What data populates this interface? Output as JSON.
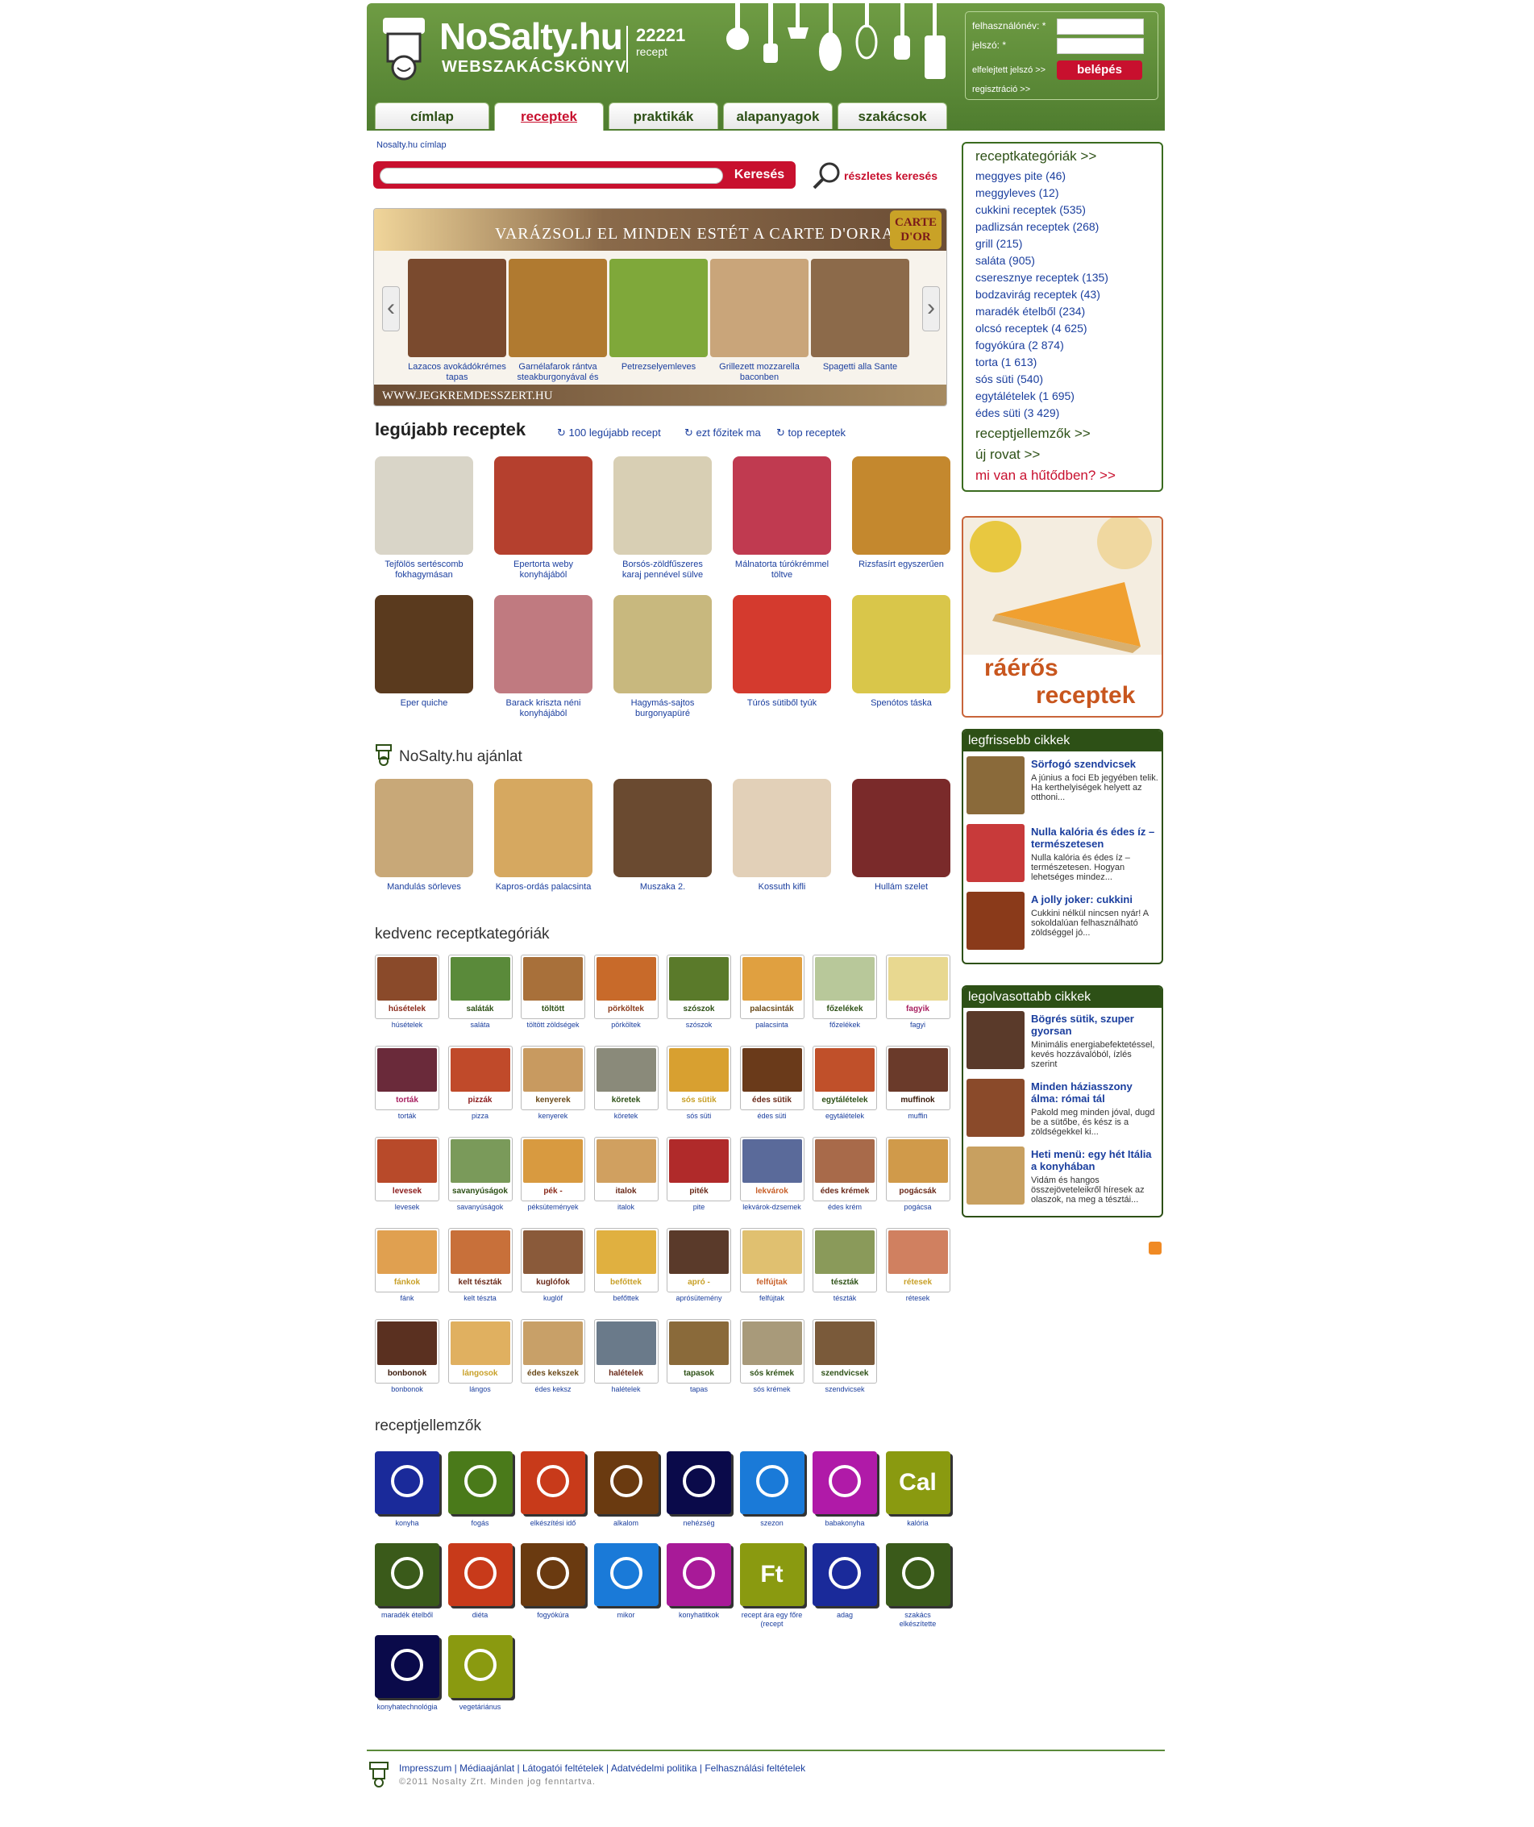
{
  "header": {
    "site_name": "NoSalty.hu",
    "tagline": "WEBSZAKÁCSKÖNYV",
    "recipe_count": "22221",
    "recipe_label": "recept"
  },
  "login": {
    "username_label": "felhasználónév: *",
    "password_label": "jelszó: *",
    "forgot_link": "elfelejtett jelszó >>",
    "register_link": "regisztráció >>",
    "submit": "belépés"
  },
  "tabs": [
    "címlap",
    "receptek",
    "praktikák",
    "alapanyagok",
    "szakácsok"
  ],
  "active_tab": "receptek",
  "breadcrumb": "Nosalty.hu címlap",
  "search": {
    "button": "Keresés",
    "advanced": "részletes keresés"
  },
  "promo": {
    "headline": "VARÁZSOLJ EL MINDEN ESTÉT A CARTE D'ORRAL!",
    "brand": "CARTE D'OR",
    "footer": "WWW.JEGKREMDESSZERT.HU",
    "items": [
      {
        "title": "Lazacos avokádókrémes tapas",
        "color": "#7a4a2e"
      },
      {
        "title": "Garnélafarok rántva steakburgonyával és",
        "color": "#b07a30"
      },
      {
        "title": "Petrezselyemleves",
        "color": "#7fa83a"
      },
      {
        "title": "Grillezett mozzarella baconben",
        "color": "#c9a57a"
      },
      {
        "title": "Spagetti alla Sante",
        "color": "#8c6a4a"
      }
    ]
  },
  "newest": {
    "title": "legújabb receptek",
    "links": [
      "100 legújabb recept",
      "ezt főzitek ma",
      "top receptek"
    ],
    "items": [
      {
        "title": "Tejfölös sertéscomb fokhagymásan",
        "color": "#d9d5c8"
      },
      {
        "title": "Epertorta weby konyhájából",
        "color": "#b5402e"
      },
      {
        "title": "Borsós-zöldfűszeres karaj pennével sülve",
        "color": "#d8cfb4"
      },
      {
        "title": "Málnatorta túrókrémmel töltve",
        "color": "#c03a50"
      },
      {
        "title": "Rizsfasírt egyszerűen",
        "color": "#c4882e"
      },
      {
        "title": "Eper quiche",
        "color": "#5a3a1e"
      },
      {
        "title": "Barack kriszta néni konyhájából",
        "color": "#c07a80"
      },
      {
        "title": "Hagymás-sajtos burgonyapüré",
        "color": "#c8b87e"
      },
      {
        "title": "Túrós sütiből tyúk",
        "color": "#d43a2e"
      },
      {
        "title": "Spenótos táska",
        "color": "#d9c64a"
      }
    ]
  },
  "recommend": {
    "title": "NoSalty.hu ajánlat",
    "items": [
      {
        "title": "Mandulás sörleves",
        "color": "#c8a878"
      },
      {
        "title": "Kapros-ordás palacsinta",
        "color": "#d6a860"
      },
      {
        "title": "Muszaka 2.",
        "color": "#6a4a30"
      },
      {
        "title": "Kossuth kifli",
        "color": "#e2d0b8"
      },
      {
        "title": "Hullám szelet",
        "color": "#7a2a2a"
      }
    ]
  },
  "categories": {
    "title": "kedvenc receptkategóriák",
    "items": [
      {
        "label": "húsételek",
        "caption": "húsételek",
        "color": "#8a4a2a",
        "lc": "#8a2a1a"
      },
      {
        "label": "saláták",
        "caption": "saláta",
        "color": "#5a8a3a",
        "lc": "#2d5016"
      },
      {
        "label": "töltött zöldségek",
        "caption": "töltött zöldségek",
        "color": "#a8703a",
        "lc": "#2d5016"
      },
      {
        "label": "pörköltek",
        "caption": "pörköltek",
        "color": "#c86a2a",
        "lc": "#8a3a1a"
      },
      {
        "label": "szószok",
        "caption": "szószok",
        "color": "#5a7a2a",
        "lc": "#2d5016"
      },
      {
        "label": "palacsinták",
        "caption": "palacsinta",
        "color": "#e0a040",
        "lc": "#6a4a1a"
      },
      {
        "label": "főzelékek",
        "caption": "főzelékek",
        "color": "#b8c89a",
        "lc": "#2d5016"
      },
      {
        "label": "fagyik",
        "caption": "fagyi",
        "color": "#e8d890",
        "lc": "#a82060"
      },
      {
        "label": "torták",
        "caption": "torták",
        "color": "#6a2a3a",
        "lc": "#a82060"
      },
      {
        "label": "pizzák",
        "caption": "pizza",
        "color": "#c04a2a",
        "lc": "#8a1a1a"
      },
      {
        "label": "kenyerek",
        "caption": "kenyerek",
        "color": "#c89a60",
        "lc": "#6a4a1a"
      },
      {
        "label": "köretek",
        "caption": "köretek",
        "color": "#8a8a7a",
        "lc": "#2d5016"
      },
      {
        "label": "sós sütik",
        "caption": "sós süti",
        "color": "#d8a030",
        "lc": "#c8a028"
      },
      {
        "label": "édes sütik",
        "caption": "édes süti",
        "color": "#6a3a1a",
        "lc": "#6a2a1a"
      },
      {
        "label": "egytálételek",
        "caption": "egytálételek",
        "color": "#c0502a",
        "lc": "#2d5016"
      },
      {
        "label": "muffinok",
        "caption": "muffin",
        "color": "#6a3a2a",
        "lc": "#3a1a0a"
      },
      {
        "label": "levesek",
        "caption": "levesek",
        "color": "#b84a2a",
        "lc": "#8a1a1a"
      },
      {
        "label": "savanyúságok",
        "caption": "savanyúságok",
        "color": "#7a9a5a",
        "lc": "#2d5016"
      },
      {
        "label": "pék - sütemények",
        "caption": "péksütemények",
        "color": "#d89a40",
        "lc": "#8a2a1a"
      },
      {
        "label": "italok",
        "caption": "italok",
        "color": "#d0a060",
        "lc": "#6a2a1a"
      },
      {
        "label": "piték",
        "caption": "pite",
        "color": "#b02a2a",
        "lc": "#6a2a1a"
      },
      {
        "label": "lekvárok dzsemek",
        "caption": "lekvárok-dzsemek",
        "color": "#5a6a9a",
        "lc": "#c8602a"
      },
      {
        "label": "édes krémek",
        "caption": "édes krém",
        "color": "#a86a4a",
        "lc": "#6a2a1a"
      },
      {
        "label": "pogácsák",
        "caption": "pogácsa",
        "color": "#d09a4a",
        "lc": "#6a2a1a"
      },
      {
        "label": "fánkok",
        "caption": "fánk",
        "color": "#e0a050",
        "lc": "#c8a028"
      },
      {
        "label": "kelt tészták",
        "caption": "kelt tészta",
        "color": "#c8703a",
        "lc": "#6a2a1a"
      },
      {
        "label": "kuglófok",
        "caption": "kuglóf",
        "color": "#8a5a3a",
        "lc": "#6a2a1a"
      },
      {
        "label": "befőttek",
        "caption": "befőttek",
        "color": "#e0b040",
        "lc": "#c8a028"
      },
      {
        "label": "apró - sütemények",
        "caption": "aprósütemény",
        "color": "#5a3a2a",
        "lc": "#c8a028"
      },
      {
        "label": "felfújtak",
        "caption": "felfújtak",
        "color": "#e0c070",
        "lc": "#c8602a"
      },
      {
        "label": "tészták",
        "caption": "tészták",
        "color": "#8a9a5a",
        "lc": "#2d5016"
      },
      {
        "label": "rétesek",
        "caption": "rétesek",
        "color": "#d08060",
        "lc": "#c8a028"
      },
      {
        "label": "bonbonok",
        "caption": "bonbonok",
        "color": "#5a3020",
        "lc": "#3a1a0a"
      },
      {
        "label": "lángosok",
        "caption": "lángos",
        "color": "#e0b060",
        "lc": "#c8a028"
      },
      {
        "label": "édes kekszek",
        "caption": "édes keksz",
        "color": "#c8a068",
        "lc": "#6a4a1a"
      },
      {
        "label": "halételek",
        "caption": "halételek",
        "color": "#6a7a8a",
        "lc": "#6a2a1a"
      },
      {
        "label": "tapasok",
        "caption": "tapas",
        "color": "#8a6a3a",
        "lc": "#2d5016"
      },
      {
        "label": "sós krémek",
        "caption": "sós krémek",
        "color": "#a89a7a",
        "lc": "#2d5016"
      },
      {
        "label": "szendvicsek",
        "caption": "szendvicsek",
        "color": "#7a5a3a",
        "lc": "#2d5016"
      }
    ]
  },
  "features": {
    "title": "receptjellemzők",
    "items": [
      {
        "caption": "konyha",
        "color": "#1a2a9a",
        "icon": "globe-icon"
      },
      {
        "caption": "fogás",
        "color": "#4a7a1a",
        "icon": "fork-knife-icon"
      },
      {
        "caption": "elkészítési idő",
        "color": "#c83a1a",
        "icon": "clock-icon"
      },
      {
        "caption": "alkalom",
        "color": "#6a3a10",
        "icon": "cake-icon"
      },
      {
        "caption": "nehézség",
        "color": "#0a0a4a",
        "icon": "spoons-icon"
      },
      {
        "caption": "szezon",
        "color": "#1a7ad8",
        "icon": "sun-snow-icon"
      },
      {
        "caption": "babakonyha",
        "color": "#b01aa8",
        "icon": "baby-icon"
      },
      {
        "caption": "kalória",
        "color": "#8a9a10",
        "icon": "cal-icon",
        "text": "Cal"
      },
      {
        "caption": "maradék ételből",
        "color": "#3a5a1a",
        "icon": "recycle-icon"
      },
      {
        "caption": "diéta",
        "color": "#c83a1a",
        "icon": "no-entry-icon"
      },
      {
        "caption": "fogyókúra",
        "color": "#6a3a10",
        "icon": "scale-icon"
      },
      {
        "caption": "mikor",
        "color": "#1a7ad8",
        "icon": "day-night-icon"
      },
      {
        "caption": "konyhatitkok",
        "color": "#a81a98",
        "icon": "lock-icon"
      },
      {
        "caption": "recept ára egy főre (recept",
        "color": "#8a9a10",
        "icon": "ft-coin-icon",
        "text": "Ft"
      },
      {
        "caption": "adag",
        "color": "#1a2a9a",
        "icon": "people-icon"
      },
      {
        "caption": "szakács elkészítette",
        "color": "#3a5a1a",
        "icon": "chef-icon"
      },
      {
        "caption": "konyhatechnológia",
        "color": "#0a0a4a",
        "icon": "gears-icon"
      },
      {
        "caption": "vegetáriánus",
        "color": "#8a9a10",
        "icon": "sprout-icon"
      }
    ]
  },
  "sidebar": {
    "cat_header": "receptkategóriák >>",
    "cat_items": [
      "meggyes pite (46)",
      "meggyleves (12)",
      "cukkini receptek (535)",
      "padlizsán receptek (268)",
      "grill (215)",
      "saláta (905)",
      "cseresznye receptek (135)",
      "bodzavirág receptek (43)",
      "maradék ételből (234)",
      "olcsó receptek (4 625)",
      "fogyókúra (2 874)",
      "torta (1 613)",
      "sós süti (540)",
      "egytálételek (1 695)",
      "édes süti (3 429)"
    ],
    "features_link": "receptjellemzők >>",
    "new_section": "új rovat >>",
    "fridge_link": "mi van a hűtődben? >>",
    "raeros_line1": "ráérős",
    "raeros_line2": "receptek",
    "latest": {
      "title": "legfrissebb cikkek",
      "items": [
        {
          "title": "Sörfogó szendvicsek",
          "text": "A június a foci Eb jegyében telik. Ha kerthelyiségek helyett az otthoni...",
          "color": "#8a6a3a"
        },
        {
          "title": "Nulla kalória és édes íz – természetesen",
          "text": "Nulla kalória és édes íz – természetesen. Hogyan lehetséges mindez...",
          "color": "#c83a3a"
        },
        {
          "title": "A jolly joker: cukkini",
          "text": "Cukkini nélkül nincsen nyár! A sokoldalúan felhasználható zöldséggel jó...",
          "color": "#8a3a1a"
        }
      ]
    },
    "most_read": {
      "title": "legolvasottabb cikkek",
      "items": [
        {
          "title": "Bögrés sütik, szuper gyorsan",
          "text": "Minimális energiabefektetéssel, kevés hozzávalóból, ízlés szerint",
          "color": "#5a3a2a"
        },
        {
          "title": "Minden háziasszony álma: római tál",
          "text": "Pakold meg minden jóval, dugd be a sütőbe, és kész is a zöldségekkel ki...",
          "color": "#8a4a2a"
        },
        {
          "title": "Heti menü: egy hét Itália a konyhában",
          "text": "Vidám és hangos összejöveteleikről híresek az olaszok, na meg a tésztái...",
          "color": "#c8a060"
        }
      ]
    }
  },
  "footer": {
    "links": "Impresszum  |  Médiaajánlat  |  Látogatói feltételek  |  Adatvédelmi politika  |  Felhasználási feltételek",
    "copyright": "©2011 Nosalty Zrt. Minden jog fenntartva."
  }
}
